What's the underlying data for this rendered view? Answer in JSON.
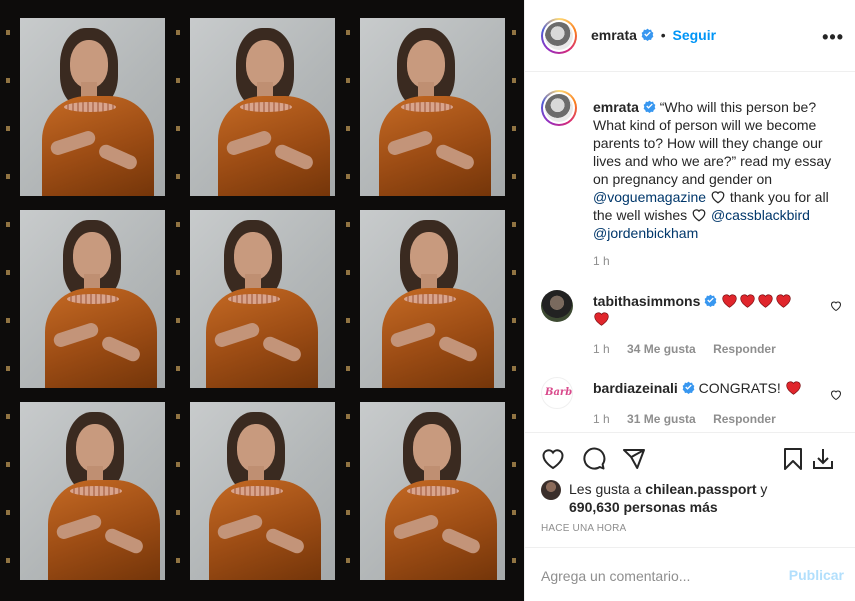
{
  "post": {
    "author": "emrata",
    "follow_label": "Seguir",
    "more_label": "•••"
  },
  "caption": {
    "author": "emrata",
    "text_1": "“Who will this person be? What kind of person will we become parents to? How will they change our lives and who we are?” read my essay on pregnancy and gender on ",
    "mention_1": "@voguemagazine",
    "text_2": " thank you for all the well wishes ",
    "mention_2": "@cassblackbird",
    "mention_3": "@jordenbickham",
    "time": "1 h"
  },
  "comments": [
    {
      "author": "tabithasimmons",
      "time": "1 h",
      "likes": "34 Me gusta",
      "reply": "Responder"
    },
    {
      "author": "bardiazeinali",
      "text": " CONGRATS! ",
      "time": "1 h",
      "likes": "31 Me gusta",
      "reply": "Responder"
    }
  ],
  "likes": {
    "prefix": "Les gusta a ",
    "user": "chilean.passport",
    "suffix_1": " y",
    "count": "690,630",
    "suffix_2": " personas más"
  },
  "posted_ago": "HACE UNA HORA",
  "composer": {
    "placeholder": "Agrega un comentario...",
    "publish_label": "Publicar"
  },
  "colors": {
    "accent": "#0095f6",
    "heart_red": "#ed4956",
    "verified_blue": "#3897f0"
  },
  "icons": [
    "heart-icon",
    "comment-icon",
    "share-icon",
    "bookmark-icon",
    "download-icon",
    "verified-icon",
    "more-options-icon"
  ]
}
